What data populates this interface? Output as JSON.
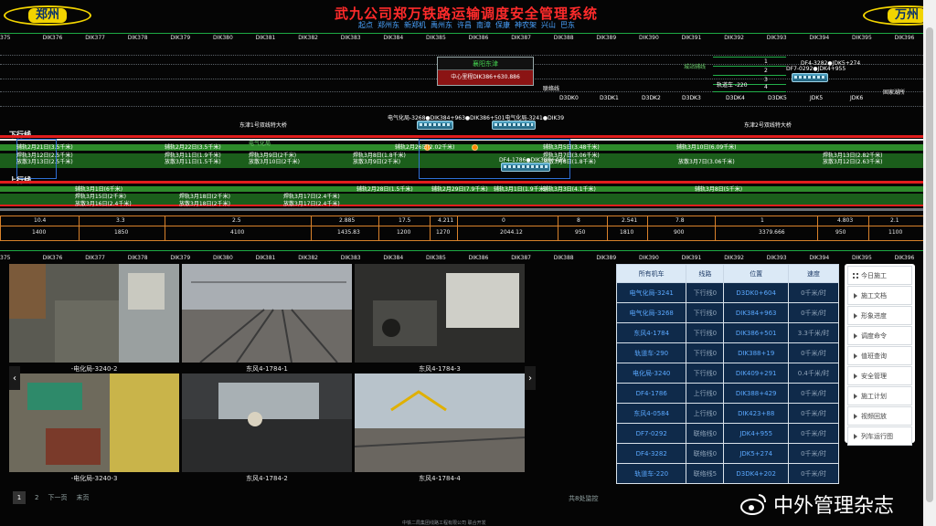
{
  "header": {
    "title": "武九公司郑万铁路运输调度安全管理系统",
    "city_left": "郑州",
    "city_right": "万州",
    "stations": [
      "起点",
      "郑州东",
      "新郑机",
      "禹州东",
      "许昌",
      "南漳",
      "保康",
      "神农架",
      "兴山",
      "巴东"
    ]
  },
  "km_top": [
    "375",
    "DIK376",
    "DIK377",
    "DIK378",
    "DIK379",
    "DIK380",
    "DIK381",
    "DIK382",
    "DIK383",
    "DIK384",
    "DIK385",
    "DIK386",
    "DIK387",
    "DIK388",
    "DIK389",
    "DIK390",
    "DIK391",
    "DIK392",
    "DIK393",
    "DIK394",
    "DIK395",
    "DIK396"
  ],
  "km_bottom": [
    "375",
    "DIK376",
    "DIK377",
    "DIK378",
    "DIK379",
    "DIK380",
    "DIK381",
    "DIK382",
    "DIK383",
    "DIK384",
    "DIK385",
    "DIK386",
    "DIK387",
    "DIK388",
    "DIK389",
    "DIK390",
    "DIK391",
    "DIK392",
    "DIK393",
    "DIK394",
    "DIK395",
    "DIK396"
  ],
  "schematic": {
    "station_name": "襄阳东津",
    "station_pos": "中心里程DIK386+630.886",
    "link_line": "联络线",
    "depot": "固家湖所",
    "yard_label": "城站辅线",
    "yard_tracks": [
      "1",
      "2",
      "3",
      "4",
      "5"
    ],
    "yard_trains": "DF4-3282●JDK5+274",
    "yard_trains2": "DF7-0292●JDK4+955",
    "yard_car": "轨道车 -220",
    "jd_marks": [
      "D3DK0",
      "D3DK1",
      "D3DK2",
      "D3DK3",
      "D3DK4",
      "D3DK5",
      "JDK5",
      "JDK6"
    ],
    "tunnel1": "东津1号双线特大桥",
    "tunnel2": "东津2号双线特大桥",
    "down_line": "下行线",
    "up_line": "上行线",
    "train_labels_top": "电气化局-3268●DIK384+963●DIK386+501电气化局-3241●DIK39",
    "work_green": "电气化局",
    "train_mid": "DF4-1786●DIK388+429",
    "works_row1": [
      "辅轨2月21日(3.5千米)",
      "辅轨2月22日(3.5千米)",
      "辅轨2月26日(2.02千米)",
      "辅轨3月5日(3.48千米)",
      "辅轨3月10日(6.09千米)"
    ],
    "works_row2a": [
      "焊轨3月12日(2.5千米)",
      "焊轨3月11日(1.9千米)",
      "焊轨3月9日(2千米)",
      "焊轨3月8日(1.8千米)",
      "焊轨3月7日(3.06千米)",
      "焊轨3月13日(2.82千米)"
    ],
    "works_row2b": [
      "放散3月13日(2.5千米)",
      "放散3月11日(1.5千米)",
      "放散3月10日(2千米)",
      "放散3月9日(2千米)",
      "放散3月8日(1.8千米)",
      "放散3月7日(3.06千米)",
      "放散3月12日(2.63千米)"
    ],
    "works_up": [
      "辅轨3月1日(6千米)",
      "辅轨2月28日(1.5千米)",
      "辅轨2月29日(7.9千米)",
      "辅轨3月1日(1.9千米)",
      "辅轨3月3日(4.1千米)",
      "辅轨3月8日(5千米)"
    ],
    "works_up2a": [
      "焊轨3月15日(2千米)",
      "焊轨3月18日(2千米)",
      "焊轨3月17日(2.4千米)"
    ],
    "works_up2b": [
      "放散3月16日(2.4千米)",
      "放散3月18日(2千米)",
      "放散3月17日(2.4千米)"
    ]
  },
  "ruler": {
    "top_values": [
      "10.4",
      "3.3",
      "2.5",
      "2.885",
      "17.5",
      "4.211",
      "0",
      "8",
      "2.541",
      "7.8",
      "1",
      "4.803",
      "2.1"
    ],
    "bottom_values": [
      "1400",
      "1850",
      "4100",
      "1435.83",
      "1200",
      "1270",
      "2044.12",
      "950",
      "1810",
      "900",
      "3379.666",
      "950",
      "1100"
    ]
  },
  "cameras": [
    {
      "caption": "-电化局-3240-2"
    },
    {
      "caption": "东风4-1784-1"
    },
    {
      "caption": "东风4-1784-3"
    },
    {
      "caption": "-电化局-3240-3"
    },
    {
      "caption": "东风4-1784-2"
    },
    {
      "caption": "东风4-1784-4"
    }
  ],
  "pager": {
    "p1": "1",
    "p2": "2",
    "next": "下一页",
    "last": "末页",
    "count": "共8处监控"
  },
  "table": {
    "headers": [
      "所有机车",
      "线路",
      "位置",
      "速度"
    ],
    "rows": [
      [
        "电气化局-3241",
        "下行线0",
        "D3DK0+604",
        "0千米/时"
      ],
      [
        "电气化局-3268",
        "下行线0",
        "DIK384+963",
        "0千米/时"
      ],
      [
        "东风4-1784",
        "下行线0",
        "DIK386+501",
        "3.3千米/时"
      ],
      [
        "轨道车-290",
        "下行线0",
        "DIK388+19",
        "0千米/时"
      ],
      [
        "电化局-3240",
        "下行线0",
        "DIK409+291",
        "0.4千米/时"
      ],
      [
        "DF4-1786",
        "上行线0",
        "DIK388+429",
        "0千米/时"
      ],
      [
        "东风4-0584",
        "上行线0",
        "DIK423+88",
        "0千米/时"
      ],
      [
        "DF7-0292",
        "联络线0",
        "JDK4+955",
        "0千米/时"
      ],
      [
        "DF4-3282",
        "联络线0",
        "JDK5+274",
        "0千米/时"
      ],
      [
        "轨道车-220",
        "联络线5",
        "D3DK4+202",
        "0千米/时"
      ]
    ]
  },
  "menu": [
    "今日施工",
    "施工文档",
    "形象进度",
    "调度命令",
    "值班查询",
    "安全管理",
    "施工计划",
    "视频回放",
    "列车运行图"
  ],
  "footer": {
    "credit": "中铁二局集团线路工程有限公司 联合开发",
    "watermark": "中外管理杂志"
  },
  "colors": {
    "title_red": "#ff2b2b",
    "track_red": "#e11d1d",
    "track_green": "#2d8a2a",
    "badge_yellow": "#f2d400",
    "table_bg": "#0f2a4a",
    "link_blue": "#5aa8ff"
  }
}
